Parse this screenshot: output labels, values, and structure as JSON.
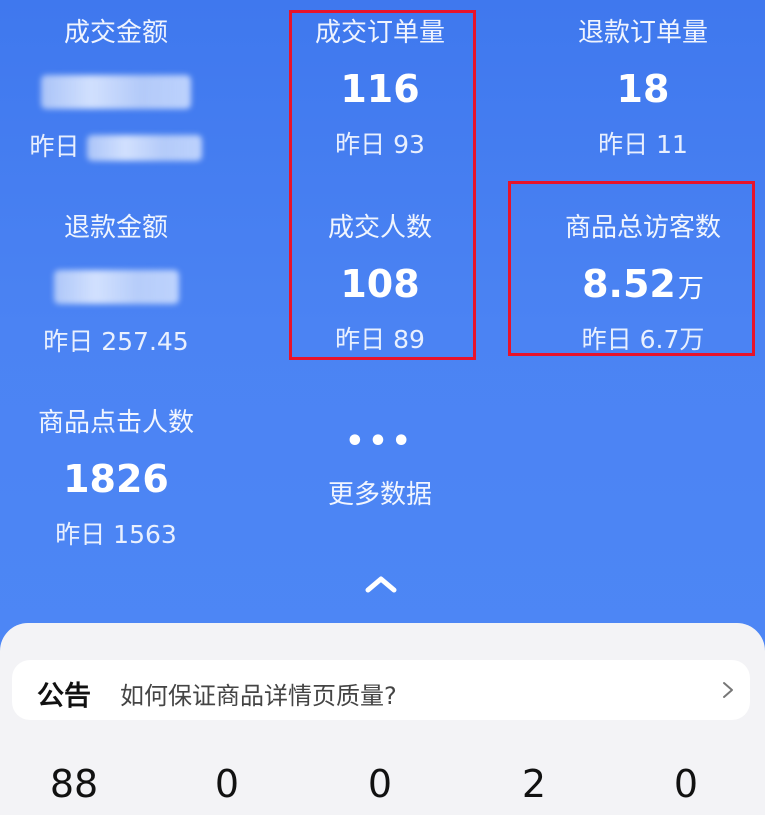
{
  "stats": {
    "gmv": {
      "label": "成交金额",
      "value": "",
      "yesterday_label": "昨日"
    },
    "orders": {
      "label": "成交订单量",
      "value": "116",
      "yesterday_label": "昨日",
      "yesterday_value": "93"
    },
    "refund_orders": {
      "label": "退款订单量",
      "value": "18",
      "yesterday_label": "昨日",
      "yesterday_value": "11"
    },
    "refund_amount": {
      "label": "退款金额",
      "value": "",
      "yesterday_label": "昨日",
      "yesterday_value": "257.45"
    },
    "buyers": {
      "label": "成交人数",
      "value": "108",
      "yesterday_label": "昨日",
      "yesterday_value": "89"
    },
    "visitors": {
      "label": "商品总访客数",
      "value": "8.52",
      "unit": "万",
      "yesterday_label": "昨日",
      "yesterday_value": "6.7万"
    },
    "clicks": {
      "label": "商品点击人数",
      "value": "1826",
      "yesterday_label": "昨日",
      "yesterday_value": "1563"
    }
  },
  "more": {
    "dots": "•••",
    "label": "更多数据"
  },
  "notice": {
    "tag": "公告",
    "text": "如何保证商品详情页质量?"
  },
  "bottom_numbers": [
    "88",
    "0",
    "0",
    "2",
    "0"
  ],
  "colors": {
    "accent_blue": "#4b83f3",
    "highlight_red": "#e8132a",
    "panel_bg": "#f3f3f6"
  }
}
